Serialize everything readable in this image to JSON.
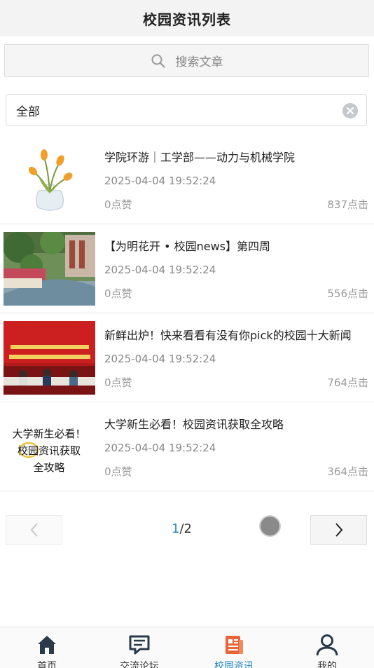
{
  "header": {
    "title": "校园资讯列表"
  },
  "search": {
    "placeholder": "搜索文章",
    "icon": "search-icon"
  },
  "filter": {
    "value": "全部",
    "clear_icon": "clear-icon"
  },
  "articles": [
    {
      "title": "学院环游｜工学部——动力与机械学院",
      "date": "2025-04-04 19:52:24",
      "likes": "0点赞",
      "clicks": "837点击",
      "thumb": "tulip-vase-image"
    },
    {
      "title": "【为明花开 • 校园news】第四周",
      "date": "2025-04-04 19:52:24",
      "likes": "0点赞",
      "clicks": "556点击",
      "thumb": "campus-garden-photo"
    },
    {
      "title": "新鲜出炉！快来看看有没有你pick的校园十大新闻",
      "date": "2025-04-04 19:52:24",
      "likes": "0点赞",
      "clicks": "764点击",
      "thumb": "meeting-banner-photo"
    },
    {
      "title": "大学新生必看！校园资讯获取全攻略",
      "date": "2025-04-04 19:52:24",
      "likes": "0点赞",
      "clicks": "364点击",
      "thumb": "handwritten-title-image",
      "thumb_text": [
        "大学新生必看！",
        "校园资讯获取",
        "全攻略"
      ]
    }
  ],
  "pager": {
    "current": "1",
    "separator": "/",
    "total": "2"
  },
  "colors": {
    "accent": "#1f88c9",
    "active_tab_icon": "#e8643a"
  },
  "tabbar": [
    {
      "label": "首页",
      "icon": "home-icon"
    },
    {
      "label": "交流论坛",
      "icon": "chat-icon"
    },
    {
      "label": "校园资讯",
      "icon": "news-icon",
      "active": true
    },
    {
      "label": "我的",
      "icon": "user-icon"
    }
  ]
}
